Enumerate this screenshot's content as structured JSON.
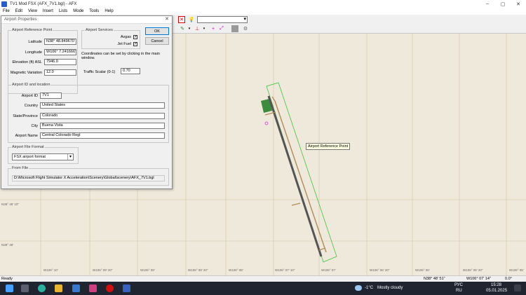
{
  "window": {
    "title": "TV1 Mod FSX (AFX_7V1.bgl) - AFX"
  },
  "menu": [
    "File",
    "Edit",
    "View",
    "Insert",
    "Lists",
    "Mode",
    "Tools",
    "Help"
  ],
  "dialog": {
    "title": "Airport Properties",
    "arp": {
      "legend": "Airport Reference Point",
      "lat_label": "Latitude",
      "lat": "N38° 48.849670'",
      "lon_label": "Longitude",
      "lon": "W106° 7.241666'",
      "elev_label": "Elevation (ft) ASL",
      "elev": "7946.0",
      "magvar_label": "Magnetic Variation",
      "magvar": "12.0"
    },
    "services": {
      "legend": "Airport Services",
      "avgas": "Avgas",
      "jetfuel": "Jet Fuel",
      "check": "✓"
    },
    "ok": "OK",
    "cancel": "Cancel",
    "note": "Coordinates can be set by clicking in the main window.",
    "traffic_label": "Traffic Scalar (0-1)",
    "traffic": "0.70",
    "idloc": {
      "legend": "Airport ID and location",
      "id_label": "Airport ID",
      "id": "7V1",
      "country_label": "Country",
      "country": "United States",
      "state_label": "State/Province",
      "state": "Colorado",
      "city_label": "City",
      "city": "Buena Vista",
      "name_label": "Airport Name",
      "name": "Central Colorado Regl"
    },
    "format": {
      "legend": "Airport File Format",
      "value": "FSX airport format"
    },
    "fromfile": {
      "legend": "From File",
      "path": "D:\\Microsoft Flight Simulator X Acceleration\\Scenery\\Global\\scenery\\AFX_7V1.bgl"
    }
  },
  "map": {
    "tooltip": "Airport Reference Point",
    "lat_labels": [
      "N38° 48' 10\"",
      "N38° 48'"
    ],
    "lon_labels": [
      "W106° 10'",
      "W106° 09' 20\"",
      "W106° 09'",
      "W106° 08' 20\"",
      "W106° 08'",
      "W106° 07' 10\"",
      "W106° 07'",
      "W106° 06' 20\"",
      "W106° 06'",
      "W106° 05' 20\"",
      "W106° 05'"
    ]
  },
  "status": {
    "left": "Ready",
    "lat": "N38° 48' 51\"",
    "lon": "W106° 07' 14\"",
    "zoom": "0.0°"
  },
  "taskbar": {
    "weather_temp": "-1°C",
    "weather_text": "Mostly cloudy",
    "lang1": "РУС",
    "lang2": "RU",
    "time": "15:28",
    "date": "05.01.2025"
  },
  "colors": {
    "taskbar": "#1f2430",
    "map_bg": "#efe9dc",
    "grid": "#d4c3a0",
    "runway": "#555555",
    "taxiway": "#b08a57",
    "boundary": "#3cc23c"
  }
}
